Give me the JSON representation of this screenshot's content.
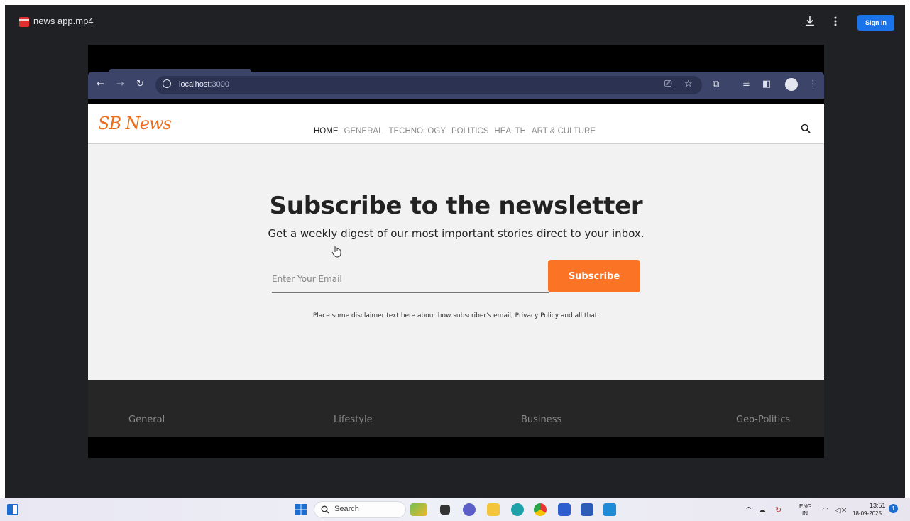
{
  "viewer": {
    "file_name": "news app.mp4",
    "sign_in_label": "Sign in",
    "accent": "#1a73e8"
  },
  "browser": {
    "url_host": "localhost",
    "url_port": ":3000"
  },
  "site": {
    "logo": "SB News",
    "brand_color": "#ea6c1d",
    "nav": [
      "HOME",
      "GENERAL",
      "TECHNOLOGY",
      "POLITICS",
      "HEALTH",
      "ART & CULTURE"
    ],
    "active_nav": "HOME",
    "newsletter": {
      "title": "Subscribe to the newsletter",
      "subtitle": "Get a weekly digest of our most important stories direct to your inbox.",
      "email_placeholder": "Enter Your Email",
      "subscribe_label": "Subscribe",
      "disclaimer": "Place some disclaimer text here about how subscriber's email, Privacy Policy and all that.",
      "button_color": "#fb7425"
    },
    "footer": {
      "columns": [
        "General",
        "Lifestyle",
        "Business",
        "Geo-Politics"
      ]
    }
  },
  "taskbar": {
    "search_label": "Search",
    "lang_top": "ENG",
    "lang_bottom": "IN",
    "time": "13:51",
    "date": "18-09-2025",
    "notification_count": "1"
  }
}
